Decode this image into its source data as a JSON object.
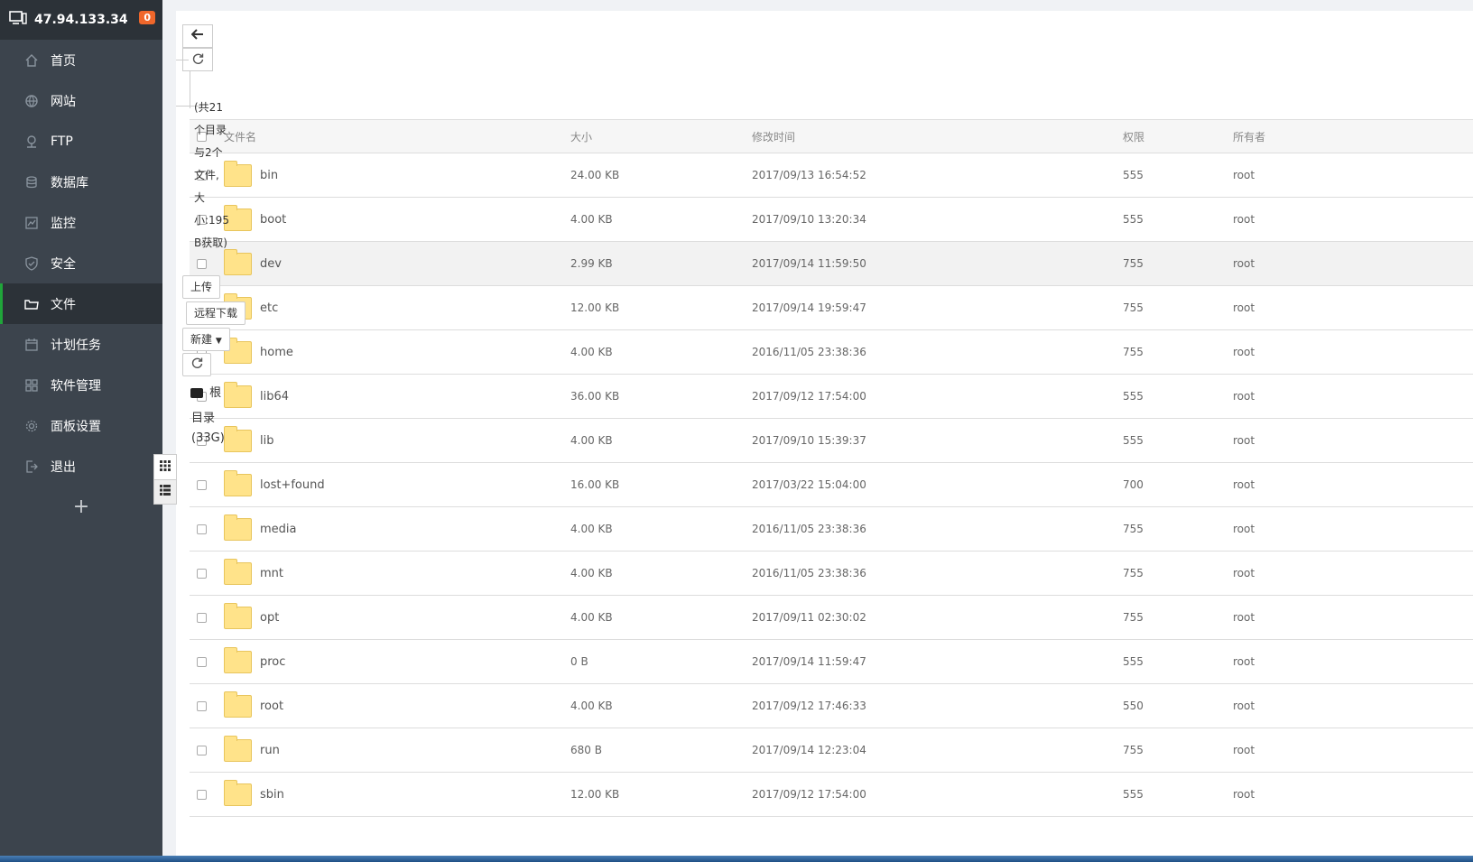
{
  "sidebar": {
    "server_ip": "47.94.133.34",
    "badge_count": "0",
    "items": [
      {
        "label": "首页",
        "icon": "home-icon"
      },
      {
        "label": "网站",
        "icon": "globe-icon"
      },
      {
        "label": "FTP",
        "icon": "ftp-icon"
      },
      {
        "label": "数据库",
        "icon": "database-icon"
      },
      {
        "label": "监控",
        "icon": "monitor-icon"
      },
      {
        "label": "安全",
        "icon": "shield-icon"
      },
      {
        "label": "文件",
        "icon": "folder-icon",
        "active": true
      },
      {
        "label": "计划任务",
        "icon": "calendar-icon"
      },
      {
        "label": "软件管理",
        "icon": "apps-icon"
      },
      {
        "label": "面板设置",
        "icon": "gear-icon"
      },
      {
        "label": "退出",
        "icon": "logout-icon"
      }
    ],
    "add_label": "+"
  },
  "toolbar": {
    "back_icon": "arrow-left-icon",
    "refresh_icon": "refresh-icon",
    "summary_lines": [
      "(共21",
      "个目录",
      "与2个",
      "文件,",
      "大",
      "小:195",
      "B获取)"
    ],
    "upload_label": "上传",
    "remote_download_label": "远程下载",
    "new_label": "新建",
    "disk_label_lines": [
      "根",
      "目录",
      "(33G)"
    ]
  },
  "table": {
    "columns": [
      "文件名",
      "大小",
      "修改时间",
      "权限",
      "所有者"
    ],
    "rows": [
      {
        "name": "bin",
        "size": "24.00 KB",
        "time": "2017/09/13 16:54:52",
        "perm": "555",
        "owner": "root"
      },
      {
        "name": "boot",
        "size": "4.00 KB",
        "time": "2017/09/10 13:20:34",
        "perm": "555",
        "owner": "root"
      },
      {
        "name": "dev",
        "size": "2.99 KB",
        "time": "2017/09/14 11:59:50",
        "perm": "755",
        "owner": "root",
        "highlight": true
      },
      {
        "name": "etc",
        "size": "12.00 KB",
        "time": "2017/09/14 19:59:47",
        "perm": "755",
        "owner": "root"
      },
      {
        "name": "home",
        "size": "4.00 KB",
        "time": "2016/11/05 23:38:36",
        "perm": "755",
        "owner": "root"
      },
      {
        "name": "lib64",
        "size": "36.00 KB",
        "time": "2017/09/12 17:54:00",
        "perm": "555",
        "owner": "root"
      },
      {
        "name": "lib",
        "size": "4.00 KB",
        "time": "2017/09/10 15:39:37",
        "perm": "555",
        "owner": "root"
      },
      {
        "name": "lost+found",
        "size": "16.00 KB",
        "time": "2017/03/22 15:04:00",
        "perm": "700",
        "owner": "root"
      },
      {
        "name": "media",
        "size": "4.00 KB",
        "time": "2016/11/05 23:38:36",
        "perm": "755",
        "owner": "root"
      },
      {
        "name": "mnt",
        "size": "4.00 KB",
        "time": "2016/11/05 23:38:36",
        "perm": "755",
        "owner": "root"
      },
      {
        "name": "opt",
        "size": "4.00 KB",
        "time": "2017/09/11 02:30:02",
        "perm": "755",
        "owner": "root"
      },
      {
        "name": "proc",
        "size": "0 B",
        "time": "2017/09/14 11:59:47",
        "perm": "555",
        "owner": "root"
      },
      {
        "name": "root",
        "size": "4.00 KB",
        "time": "2017/09/12 17:46:33",
        "perm": "550",
        "owner": "root"
      },
      {
        "name": "run",
        "size": "680 B",
        "time": "2017/09/14 12:23:04",
        "perm": "755",
        "owner": "root"
      },
      {
        "name": "sbin",
        "size": "12.00 KB",
        "time": "2017/09/12 17:54:00",
        "perm": "555",
        "owner": "root"
      }
    ]
  },
  "colors": {
    "sidebar_bg": "#3c444d",
    "sidebar_active_bg": "#2c3238",
    "accent_green": "#20a53a",
    "badge_orange": "#f0672b",
    "folder_yellow": "#ffe38a"
  }
}
